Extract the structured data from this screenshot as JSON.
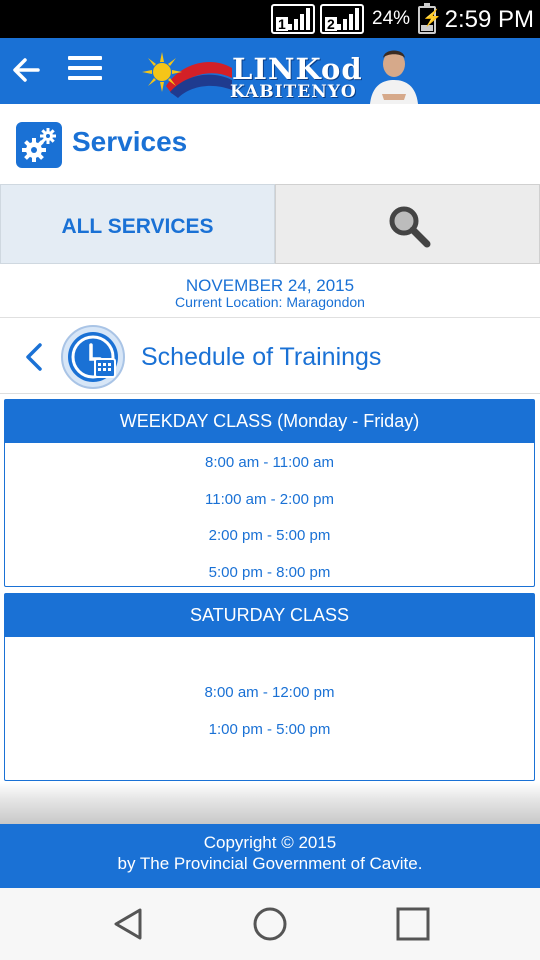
{
  "status_bar": {
    "sim1": "1",
    "sim2": "2",
    "battery_percent": "24%",
    "battery_level": 0.24,
    "time": "2:59 PM"
  },
  "app_bar": {
    "logo_line1": "LINKod",
    "logo_line2": "KABITENYO",
    "back_icon": "arrow-left-icon",
    "menu_icon": "hamburger-menu-icon"
  },
  "services": {
    "title": "Services",
    "icon": "gears-icon"
  },
  "tabs": {
    "all_services": "ALL SERVICES",
    "search_icon": "search-icon"
  },
  "date_block": {
    "date": "NOVEMBER 24, 2015",
    "location": "Current Location: Maragondon"
  },
  "section": {
    "title": "Schedule of Trainings",
    "icon": "clock-calendar-icon"
  },
  "classes": [
    {
      "title": "WEEKDAY CLASS (Monday - Friday)",
      "slots": [
        "8:00 am - 11:00 am",
        "11:00 am - 2:00 pm",
        "2:00 pm - 5:00 pm",
        "5:00 pm - 8:00 pm"
      ]
    },
    {
      "title": "SATURDAY CLASS",
      "slots": [
        "8:00 am - 12:00 pm",
        "1:00 pm - 5:00 pm"
      ]
    }
  ],
  "footer": {
    "line1": "Copyright © 2015",
    "line2": "by The Provincial Government of Cavite."
  },
  "nav_bar": {
    "back_icon": "triangle-back-icon",
    "home_icon": "circle-home-icon",
    "recents_icon": "square-recents-icon"
  },
  "colors": {
    "primary": "#1a71d5",
    "tab_bg": "#e4ecf4",
    "status_bar": "#000000"
  }
}
